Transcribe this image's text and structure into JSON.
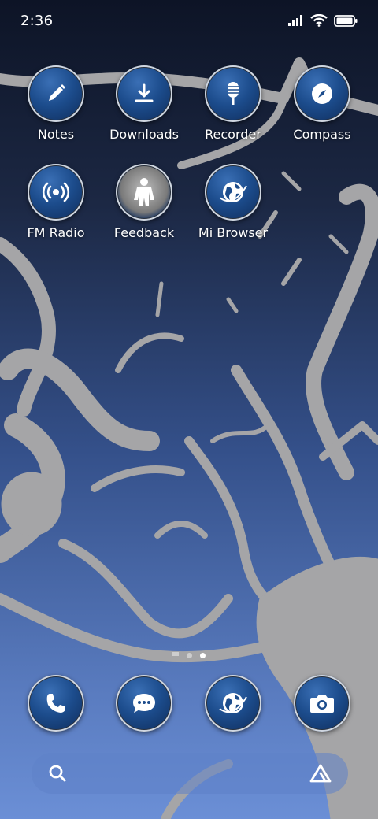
{
  "status_bar": {
    "time": "2:36",
    "icons": [
      "signal-icon",
      "wifi-icon",
      "battery-icon"
    ]
  },
  "home": {
    "rows": [
      [
        {
          "label": "Notes",
          "icon": "pencil-icon"
        },
        {
          "label": "Downloads",
          "icon": "download-icon"
        },
        {
          "label": "Recorder",
          "icon": "microphone-icon"
        },
        {
          "label": "Compass",
          "icon": "compass-icon"
        }
      ],
      [
        {
          "label": "FM Radio",
          "icon": "radio-icon"
        },
        {
          "label": "Feedback",
          "icon": "feedback-person-icon"
        },
        {
          "label": "Mi Browser",
          "icon": "globe-icon"
        }
      ]
    ],
    "page_indicator": {
      "pages": 2,
      "active": 2
    }
  },
  "dock": [
    {
      "name": "phone",
      "icon": "phone-icon"
    },
    {
      "name": "messages",
      "icon": "message-icon"
    },
    {
      "name": "browser",
      "icon": "globe-icon"
    },
    {
      "name": "camera",
      "icon": "camera-icon"
    }
  ],
  "search": {
    "icon": "search-icon",
    "assistant_icon": "assistant-icon"
  },
  "colors": {
    "icon_fill": "#1c4c8c",
    "wallpaper_splash": "#a6a6a6"
  }
}
